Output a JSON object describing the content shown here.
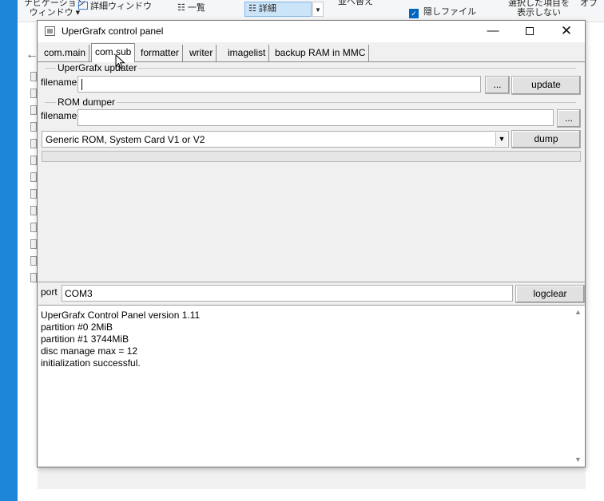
{
  "background": {
    "ribbon": {
      "nav_pane_line1": "ナビゲーション",
      "nav_pane_line2": "ウィンドウ ▾",
      "detail_pane": "詳細ウィンドウ",
      "list_view": "一覧",
      "detail_view": "詳細",
      "sort": "並べ替え",
      "hidden_files": "隠しファイル",
      "hide_selected_line1": "選択した項目を",
      "hide_selected_line2": "表示しない",
      "options": "オプ"
    }
  },
  "window": {
    "title": "UperGrafx control panel",
    "controls": {
      "minimize": "—",
      "close": "✕"
    }
  },
  "tabs": [
    {
      "label": "com.main"
    },
    {
      "label": "com.sub"
    },
    {
      "label": "formatter"
    },
    {
      "label": "writer"
    },
    {
      "label": "imagelist"
    },
    {
      "label": "backup RAM in MMC"
    }
  ],
  "active_tab": "com.sub",
  "updater": {
    "group_label": "UperGrafx updater",
    "filename_label": "filename",
    "filename_value": "",
    "browse_label": "...",
    "update_label": "update"
  },
  "dumper": {
    "group_label": "ROM dumper",
    "filename_label": "filename",
    "filename_value": "",
    "browse_label": "...",
    "rom_type_selected": "Generic ROM, System Card V1 or V2",
    "dump_label": "dump",
    "progress": 0
  },
  "port": {
    "label": "port",
    "value": "COM3",
    "logclear_label": "logclear"
  },
  "log": [
    "UperGrafx Control Panel version 1.11",
    "partition #0 2MiB",
    "partition #1 3744MiB",
    "disc manage max = 12",
    "initialization successful."
  ]
}
